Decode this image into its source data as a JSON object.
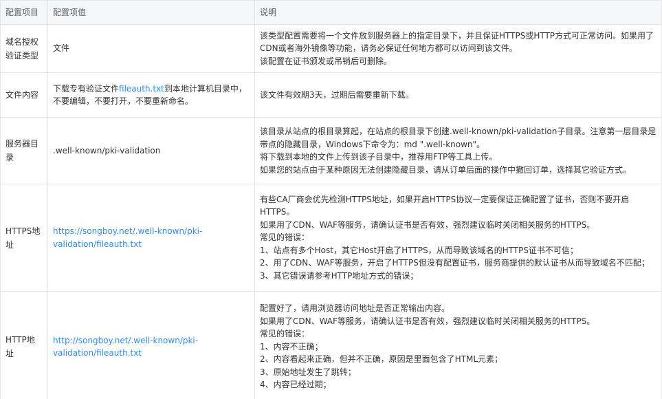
{
  "headers": {
    "col1": "配置项目",
    "col2": "配置项值",
    "col3": "说明"
  },
  "rows": [
    {
      "name": "域名授权验证类型",
      "value_text": "文件",
      "desc_lines": [
        "该类型配置需要将一个文件放到服务器上的指定目录下，并且保证HTTPS或HTTP方式可正常访问。如果用了CDN或者海外镜像等功能，请务必保证任何地方都可以访问到该文件。",
        "该配置在证书颁发或吊销后可删除。"
      ]
    },
    {
      "name": "文件内容",
      "value_prefix": "下载专有验证文件",
      "value_link": "fileauth.txt",
      "value_suffix": "到本地计算机目录中，不要编辑，不要打开，不要重新命名。",
      "desc_lines": [
        "该文件有效期3天，过期后需要重新下载。"
      ]
    },
    {
      "name": "服务器目录",
      "value_text": ".well-known/pki-validation",
      "desc_lines": [
        "该目录从站点的根目录算起，在站点的根目录下创建.well-known/pki-validation子目录。注意第一层目录是带点的隐藏目录，Windows下命令为：md \".well-known\"。",
        "将下载到本地的文件上传到该子目录中，推荐用FTP等工具上传。",
        "如果您的站点由于某种原因无法创建隐藏目录，请从订单后面的操作中撤回订单，选择其它验证方式。"
      ]
    },
    {
      "name": "HTTPS地址",
      "value_link": "https://songboy.net/.well-known/pki-validation/fileauth.txt",
      "desc_lines": [
        "有些CA厂商会优先检测HTTPS地址，如果开启HTTPS协议一定要保证正确配置了证书，否则不要开启HTTPS。",
        "如果用了CDN、WAF等服务，请确认证书是否有效，强烈建议临时关闭相关服务的HTTPS。",
        "常见的错误：",
        "1、站点有多个Host，其它Host开启了HTTPS，从而导致该域名的HTTPS证书不可信；",
        "2、用了CDN、WAF等服务，开启了HTTPS但没有配置证书，服务商提供的默认证书从而导致域名不匹配；",
        "3、其它错误请参考HTTP地址方式的错误；"
      ]
    },
    {
      "name": "HTTP地址",
      "value_link": "http://songboy.net/.well-known/pki-validation/fileauth.txt",
      "desc_lines": [
        "配置好了，请用浏览器访问地址是否正常输出内容。",
        "如果用了CDN、WAF等服务，请确认证书是否有效，强烈建议临时关闭相关服务的HTTPS。",
        "常见的错误：",
        "1、内容不正确；",
        "2、内容看起来正确，但并不正确，原因是里面包含了HTML元素；",
        "3、原始地址发生了跳转；",
        "4、内容已经过期；"
      ]
    }
  ]
}
